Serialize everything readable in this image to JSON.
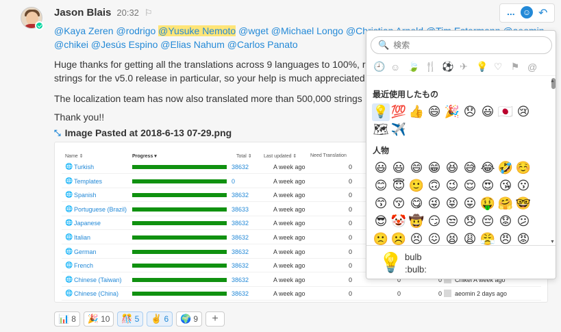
{
  "post": {
    "username": "Jason Blais",
    "time": "20:32",
    "mentions": [
      "@Kaya Zeren",
      "@rodrigo",
      "@Yusuke Nemoto",
      "@wget",
      "@Michael Longo",
      "@Christian Arnold",
      "@Tim Estermann",
      "@aeomin",
      "@chikei",
      "@Jesús Espino",
      "@Elias Nahum",
      "@Carlos Panato"
    ],
    "para1_line1": "Huge thanks for getting all the translations across 9 languages to 100%, r",
    "para1_line2": "strings for the v5.0 release in particular, so your help is much appreciated",
    "para2": "The localization team has now also translated more than 500,000 strings",
    "para3": "Thank you!!",
    "attachment_title": "Image Pasted at 2018-6-13 07-29.png"
  },
  "image_table": {
    "headers": {
      "name": "Name",
      "progress": "Progress",
      "total": "Total",
      "updated": "Last updated",
      "need": "Need Translation"
    },
    "rows": [
      {
        "lang": "Turkish",
        "total": "38632",
        "updated": "A week ago",
        "need": "0",
        "c5": "",
        "c6": "",
        "user": ""
      },
      {
        "lang": "Templates",
        "total": "0",
        "updated": "A week ago",
        "need": "0",
        "c5": "",
        "c6": "",
        "user": ""
      },
      {
        "lang": "Spanish",
        "total": "38632",
        "updated": "A week ago",
        "need": "0",
        "c5": "",
        "c6": "",
        "user": ""
      },
      {
        "lang": "Portuguese (Brazil)",
        "total": "38633",
        "updated": "A week ago",
        "need": "0",
        "c5": "",
        "c6": "",
        "user": ""
      },
      {
        "lang": "Japanese",
        "total": "38632",
        "updated": "A week ago",
        "need": "0",
        "c5": "",
        "c6": "",
        "user": ""
      },
      {
        "lang": "Italian",
        "total": "38632",
        "updated": "A week ago",
        "need": "0",
        "c5": "",
        "c6": "",
        "user": ""
      },
      {
        "lang": "German",
        "total": "38632",
        "updated": "A week ago",
        "need": "0",
        "c5": "",
        "c6": "",
        "user": ""
      },
      {
        "lang": "French",
        "total": "38632",
        "updated": "A week ago",
        "need": "0",
        "c5": "",
        "c6": "",
        "user": ""
      },
      {
        "lang": "Chinese (Taiwan)",
        "total": "38632",
        "updated": "A week ago",
        "need": "0",
        "c5": "0",
        "c6": "0",
        "user": "Chikei A week ago"
      },
      {
        "lang": "Chinese (China)",
        "total": "38632",
        "updated": "A week ago",
        "need": "0",
        "c5": "0",
        "c6": "0",
        "user": "aeomin 2 days ago"
      }
    ]
  },
  "reactions": [
    {
      "emoji": "📊",
      "count": "8",
      "mine": false
    },
    {
      "emoji": "🎉",
      "count": "10",
      "mine": false
    },
    {
      "emoji": "🎊",
      "count": "5",
      "mine": true
    },
    {
      "emoji": "✌",
      "count": "6",
      "mine": true
    },
    {
      "emoji": "🌍",
      "count": "9",
      "mine": false
    }
  ],
  "toolbar": {
    "more": "...",
    "emoji": "☺",
    "reply": "↶"
  },
  "picker": {
    "search_placeholder": "検索",
    "categories": [
      "🕘",
      "☺",
      "🍃",
      "🍴",
      "⚽",
      "✈",
      "💡",
      "♡",
      "⚑",
      "@"
    ],
    "recent_title": "最近使用したもの",
    "recent": [
      "💡",
      "💯",
      "👍",
      "😄",
      "🎉",
      "😞",
      "😃",
      "🇯🇵",
      "😢",
      "🗺",
      "✈️"
    ],
    "people_title": "人物",
    "people": [
      "😃",
      "😃",
      "😄",
      "😁",
      "😆",
      "😅",
      "😂",
      "🤣",
      "☺️",
      "😊",
      "😇",
      "🙂",
      "🙃",
      "😉",
      "😌",
      "😍",
      "😘",
      "😗",
      "😙",
      "😚",
      "😋",
      "😜",
      "😝",
      "😛",
      "🤑",
      "🤗",
      "🤓",
      "😎",
      "🤡",
      "🤠",
      "😏",
      "😒",
      "😞",
      "😔",
      "😟",
      "😕",
      "🙁",
      "☹️",
      "😣",
      "😖",
      "😫",
      "😩",
      "😤",
      "😠",
      "😡"
    ],
    "preview_emoji": "💡",
    "preview_name": "bulb",
    "preview_alias": ":bulb:"
  }
}
